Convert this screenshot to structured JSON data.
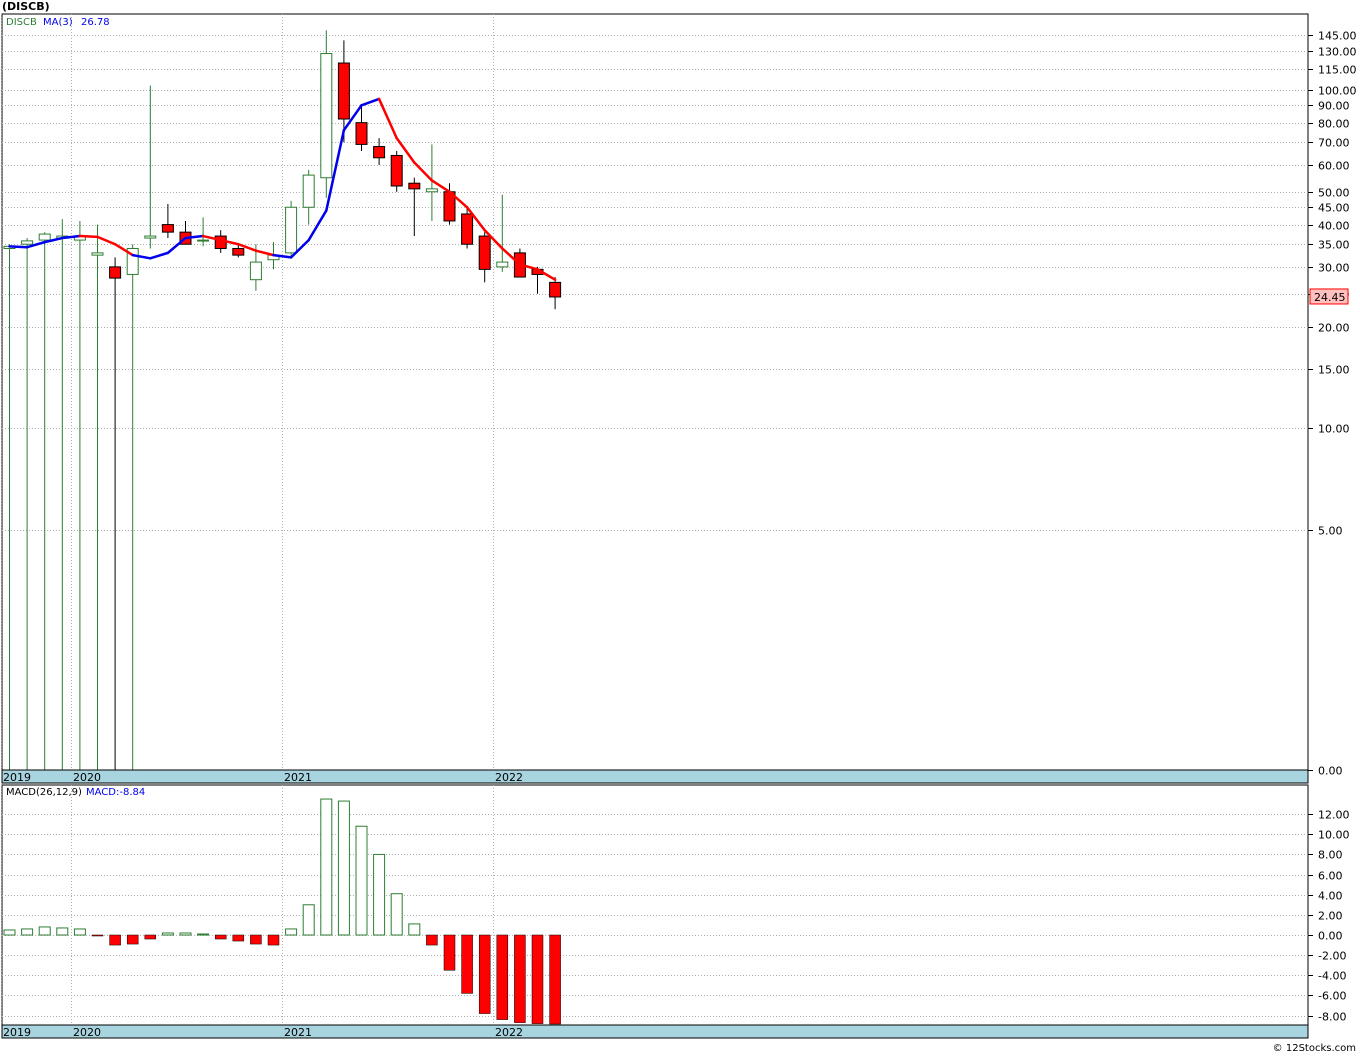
{
  "title": "(DISCB)",
  "watermark": "© 12Stocks.com",
  "colors": {
    "up": "#2e7d32",
    "down": "#ff0000",
    "ma_up": "#0000ee",
    "ma_down": "#ff0000",
    "axis_bar": "#a8d4e0"
  },
  "chart_data": [
    {
      "type": "candlestick",
      "scale": "log",
      "legend": {
        "symbol": "DISCB",
        "ma_label": "MA(3)",
        "ma_value": "26.78"
      },
      "last_price_label": "24.45",
      "last_price": 24.45,
      "y_ticks": [
        {
          "v": 145,
          "label": "145.00"
        },
        {
          "v": 130,
          "label": "130.00"
        },
        {
          "v": 115,
          "label": "115.00"
        },
        {
          "v": 100,
          "label": "100.00"
        },
        {
          "v": 90,
          "label": "90.00"
        },
        {
          "v": 80,
          "label": "80.00"
        },
        {
          "v": 70,
          "label": "70.00"
        },
        {
          "v": 60,
          "label": "60.00"
        },
        {
          "v": 50,
          "label": "50.00"
        },
        {
          "v": 45,
          "label": "45.00"
        },
        {
          "v": 40,
          "label": "40.00"
        },
        {
          "v": 35,
          "label": "35.00"
        },
        {
          "v": 30,
          "label": "30.00"
        },
        {
          "v": 25,
          "label": "25.00"
        },
        {
          "v": 20,
          "label": "20.00"
        },
        {
          "v": 15,
          "label": "15.00"
        },
        {
          "v": 10,
          "label": "10.00"
        },
        {
          "v": 5,
          "label": "5.00"
        },
        {
          "v": 0,
          "label": "0.00"
        }
      ],
      "x_labels": [
        {
          "i": 0,
          "label": "2019"
        },
        {
          "i": 4,
          "label": "2020"
        },
        {
          "i": 16,
          "label": "2021"
        },
        {
          "i": 28,
          "label": "2022"
        }
      ],
      "candles": [
        {
          "o": 34.0,
          "h": 35.0,
          "l": 0,
          "c": 34.5
        },
        {
          "o": 35.0,
          "h": 36.5,
          "l": 0,
          "c": 35.8
        },
        {
          "o": 36.0,
          "h": 38.0,
          "l": 0,
          "c": 37.5
        },
        {
          "o": 36.5,
          "h": 41.5,
          "l": 0,
          "c": 37.0
        },
        {
          "o": 36.0,
          "h": 41.0,
          "l": 0,
          "c": 37.0
        },
        {
          "o": 32.5,
          "h": 40.0,
          "l": 0,
          "c": 33.0
        },
        {
          "o": 30.0,
          "h": 32.0,
          "l": 0,
          "c": 27.8
        },
        {
          "o": 28.5,
          "h": 35.0,
          "l": 0,
          "c": 34.0
        },
        {
          "o": 36.5,
          "h": 103.0,
          "l": 34.0,
          "c": 37.0
        },
        {
          "o": 40.0,
          "h": 46.0,
          "l": 36.5,
          "c": 38.0
        },
        {
          "o": 38.0,
          "h": 41.0,
          "l": 35.5,
          "c": 35.0
        },
        {
          "o": 36.0,
          "h": 42.0,
          "l": 34.5,
          "c": 36.0
        },
        {
          "o": 37.0,
          "h": 38.5,
          "l": 33.0,
          "c": 34.0
        },
        {
          "o": 34.0,
          "h": 35.0,
          "l": 32.0,
          "c": 32.5
        },
        {
          "o": 27.5,
          "h": 35.0,
          "l": 25.5,
          "c": 31.0
        },
        {
          "o": 31.5,
          "h": 35.5,
          "l": 29.5,
          "c": 32.5
        },
        {
          "o": 33.0,
          "h": 47.0,
          "l": 32.0,
          "c": 45.0
        },
        {
          "o": 45.0,
          "h": 58.0,
          "l": 40.0,
          "c": 56.0
        },
        {
          "o": 55.0,
          "h": 150.0,
          "l": 48.0,
          "c": 128.0
        },
        {
          "o": 120.0,
          "h": 140.0,
          "l": 70.0,
          "c": 82.0
        },
        {
          "o": 80.0,
          "h": 90.0,
          "l": 66.0,
          "c": 69.0
        },
        {
          "o": 68.0,
          "h": 72.0,
          "l": 60.0,
          "c": 63.0
        },
        {
          "o": 64.0,
          "h": 66.0,
          "l": 50.0,
          "c": 52.0
        },
        {
          "o": 53.0,
          "h": 55.0,
          "l": 37.0,
          "c": 51.0
        },
        {
          "o": 50.0,
          "h": 69.0,
          "l": 41.0,
          "c": 51.0
        },
        {
          "o": 50.0,
          "h": 53.0,
          "l": 40.0,
          "c": 41.0
        },
        {
          "o": 43.0,
          "h": 45.0,
          "l": 34.0,
          "c": 35.0
        },
        {
          "o": 37.0,
          "h": 38.0,
          "l": 27.0,
          "c": 29.5
        },
        {
          "o": 30.0,
          "h": 49.0,
          "l": 29.0,
          "c": 31.0
        },
        {
          "o": 33.0,
          "h": 34.0,
          "l": 28.0,
          "c": 28.0
        },
        {
          "o": 29.5,
          "h": 30.0,
          "l": 25.0,
          "c": 28.5
        },
        {
          "o": 27.0,
          "h": 28.0,
          "l": 22.5,
          "c": 24.45
        }
      ],
      "ma": [
        34.5,
        34.3,
        35.5,
        36.5,
        37.0,
        36.8,
        35.0,
        32.5,
        31.8,
        33.0,
        36.5,
        37.0,
        36.0,
        35.0,
        33.5,
        32.5,
        32.0,
        36.0,
        44.0,
        76.0,
        90.0,
        94.0,
        72.0,
        61.0,
        54.0,
        50.0,
        45.0,
        38.5,
        34.0,
        30.5,
        29.5,
        27.5
      ],
      "ma_colors": [
        "r",
        "b",
        "b",
        "b",
        "b",
        "r",
        "r",
        "r",
        "b",
        "b",
        "b",
        "b",
        "r",
        "r",
        "r",
        "r",
        "b",
        "b",
        "b",
        "b",
        "b",
        "b",
        "r",
        "r",
        "r",
        "r",
        "r",
        "r",
        "r",
        "r",
        "r",
        "r"
      ]
    },
    {
      "type": "bar",
      "legend": {
        "label": "MACD(26,12,9)",
        "value_label": "MACD:-8.84"
      },
      "y_ticks": [
        {
          "v": 12,
          "label": "12.00"
        },
        {
          "v": 10,
          "label": "10.00"
        },
        {
          "v": 8,
          "label": "8.00"
        },
        {
          "v": 6,
          "label": "6.00"
        },
        {
          "v": 4,
          "label": "4.00"
        },
        {
          "v": 2,
          "label": "2.00"
        },
        {
          "v": 0,
          "label": "0.00"
        },
        {
          "v": -2,
          "label": "-2.00"
        },
        {
          "v": -4,
          "label": "-4.00"
        },
        {
          "v": -6,
          "label": "-6.00"
        },
        {
          "v": -8,
          "label": "-8.00"
        }
      ],
      "ylim": [
        -8.9,
        13.8
      ],
      "x_labels": [
        {
          "i": 0,
          "label": "2019"
        },
        {
          "i": 4,
          "label": "2020"
        },
        {
          "i": 16,
          "label": "2021"
        },
        {
          "i": 28,
          "label": "2022"
        }
      ],
      "values": [
        0.5,
        0.6,
        0.8,
        0.7,
        0.6,
        -0.1,
        -1.0,
        -0.9,
        -0.4,
        0.2,
        0.2,
        0.1,
        -0.4,
        -0.6,
        -0.9,
        -1.0,
        0.6,
        3.0,
        13.5,
        13.3,
        10.8,
        8.0,
        4.1,
        1.1,
        -1.0,
        -3.5,
        -5.8,
        -7.8,
        -8.4,
        -8.7,
        -8.8,
        -8.84
      ]
    }
  ]
}
